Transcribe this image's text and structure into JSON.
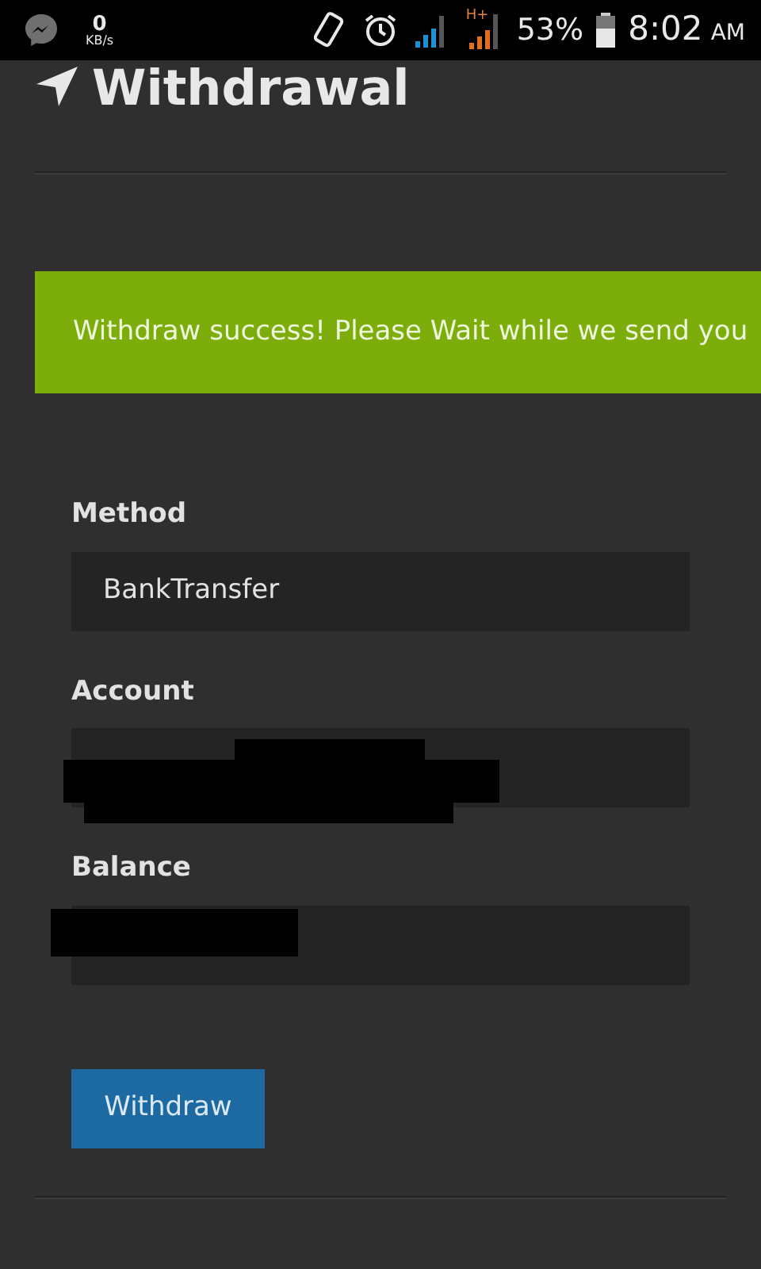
{
  "status_bar": {
    "speed_value": "0",
    "speed_unit": "KB/s",
    "network": "H+",
    "battery": "53%",
    "time": "8:02",
    "meridiem": "AM"
  },
  "header": {
    "title": "Withdrawal"
  },
  "alert": {
    "text": "Withdraw success! Please Wait while we send you"
  },
  "fields": [
    {
      "label": "Method",
      "value": "BankTransfer",
      "redacted": false
    },
    {
      "label": "Account",
      "redacted": true
    },
    {
      "label": "Balance",
      "redacted": true
    }
  ],
  "button": {
    "label": "Withdraw"
  }
}
